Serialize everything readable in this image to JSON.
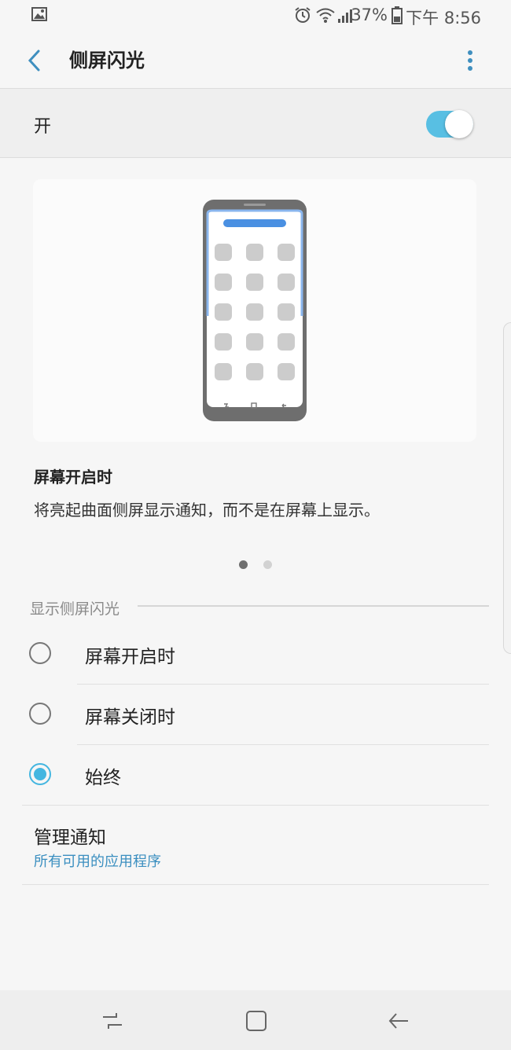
{
  "status_bar": {
    "battery_percent": "37%",
    "time": "下午 8:56",
    "icons": [
      "image-icon",
      "alarm-icon",
      "wifi-icon",
      "signal-icon",
      "battery-icon"
    ]
  },
  "header": {
    "title": "侧屏闪光",
    "back_icon": "chevron-left-icon",
    "more_icon": "more-vertical-icon"
  },
  "master_switch": {
    "label": "开",
    "on": true
  },
  "illustration": {
    "page_indicator": {
      "current": 1,
      "total": 2
    },
    "caption_title": "屏幕开启时",
    "caption_body": "将亮起曲面侧屏显示通知，而不是在屏幕上显示。"
  },
  "section": {
    "label": "显示侧屏闪光",
    "options": [
      {
        "label": "屏幕开启时",
        "selected": false
      },
      {
        "label": "屏幕关闭时",
        "selected": false
      },
      {
        "label": "始终",
        "selected": true
      }
    ]
  },
  "manage": {
    "title": "管理通知",
    "subtitle": "所有可用的应用程序"
  },
  "navbar": {
    "icons": [
      "recent-apps-icon",
      "home-icon",
      "back-icon"
    ]
  },
  "colors": {
    "accent": "#44b6e0",
    "toggle_on": "#58bfe3",
    "link": "#3b8fc0"
  }
}
